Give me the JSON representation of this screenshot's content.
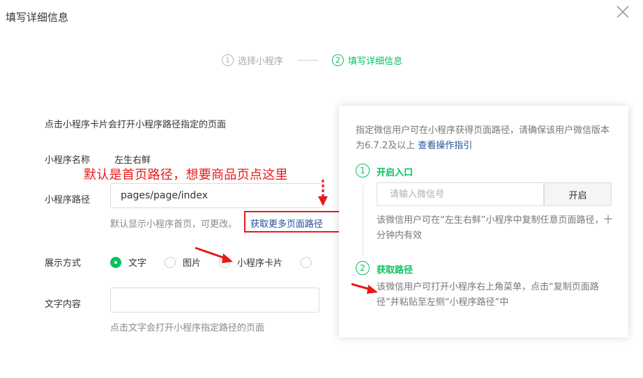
{
  "dialog": {
    "title": "填写详细信息",
    "close_icon": "close-icon"
  },
  "steps": [
    {
      "number": "1",
      "label": "选择小程序",
      "state": "inactive"
    },
    {
      "number": "2",
      "label": "填写详细信息",
      "state": "active"
    }
  ],
  "form": {
    "description": "点击小程序卡片会打开小程序路径指定的页面",
    "mp_name_label": "小程序名称",
    "mp_name_value": "左生右鲜",
    "annotation": "默认是首页路径，想要商品页点这里",
    "path_label": "小程序路径",
    "path_value": "pages/page/index",
    "path_hint": "默认显示小程序首页，可更改。",
    "more_path_link": "获取更多页面路径",
    "display_label": "展示方式",
    "display_options": [
      "文字",
      "图片",
      "小程序卡片"
    ],
    "display_selected": "文字",
    "text_content_label": "文字内容",
    "text_content_value": "",
    "text_hint": "点击文字会打开小程序指定路径的页面"
  },
  "popover": {
    "intro": "指定微信用户可在小程序获得页面路径，请确保该用户微信版本为6.7.2及以上",
    "guide_link": "查看操作指引",
    "step1_number": "1",
    "step1_title": "开启入口",
    "wechat_input_placeholder": "请输入微信号",
    "open_button": "开启",
    "step1_desc": "该微信用户可在“左生右鲜”小程序中复制任意页面路径，十分钟内有效",
    "step2_number": "2",
    "step2_title": "获取路径",
    "step2_desc": "该微信用户可打开小程序右上角菜单，点击“复制页面路径”并粘贴至左侧“小程序路径”中"
  },
  "colors": {
    "accent_green": "#07c160",
    "link_blue": "#1f4f9a",
    "annotation_red": "#e81818"
  }
}
